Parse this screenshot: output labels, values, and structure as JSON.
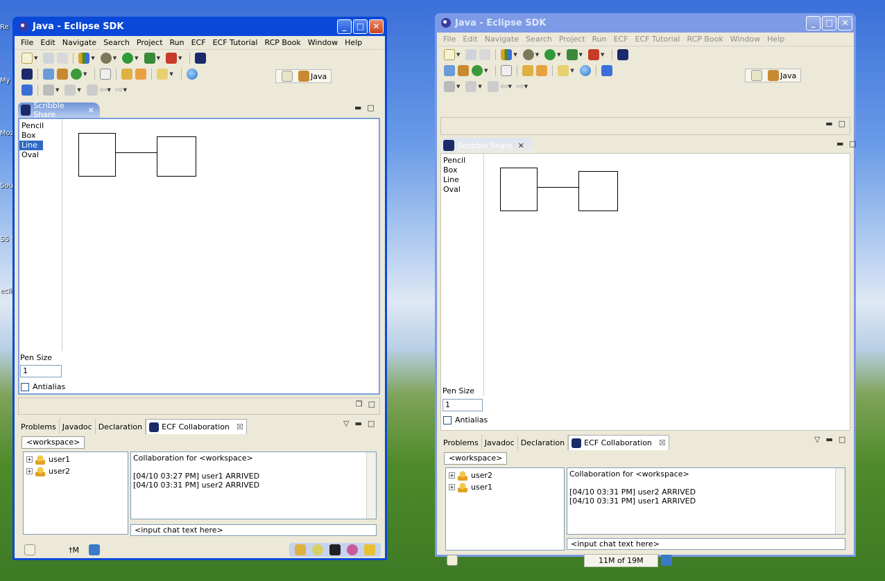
{
  "desktop": {
    "icons": [
      "Re",
      "My",
      "Moz",
      "Sou",
      "SS SH",
      "eclip"
    ]
  },
  "windows": [
    {
      "title": "Java - Eclipse SDK",
      "menu": [
        "File",
        "Edit",
        "Navigate",
        "Search",
        "Project",
        "Run",
        "ECF",
        "ECF Tutorial",
        "RCP Book",
        "Window",
        "Help"
      ],
      "perspective": "Java",
      "scribble_tab": "Scribble Share",
      "tools": [
        "Pencil",
        "Box",
        "Line",
        "Oval"
      ],
      "selected_tool": "Line",
      "pen_size_label": "Pen Size",
      "pen_size_value": "1",
      "antialias_label": "Antialias",
      "tabs": [
        "Problems",
        "Javadoc",
        "Declaration",
        "ECF Collaboration"
      ],
      "workspace_tab": "<workspace>",
      "users": [
        "user1",
        "user2"
      ],
      "chat_lines": [
        "Collaboration for <workspace>",
        "",
        "[04/10 03:27 PM] user1 ARRIVED",
        "[04/10 03:31 PM] user2 ARRIVED"
      ],
      "chat_input_placeholder": "<input chat text here>",
      "status_text": "†M"
    },
    {
      "title": "Java - Eclipse SDK",
      "menu": [
        "File",
        "Edit",
        "Navigate",
        "Search",
        "Project",
        "Run",
        "ECF",
        "ECF Tutorial",
        "RCP Book",
        "Window",
        "Help"
      ],
      "perspective": "Java",
      "scribble_tab": "Scribble Share",
      "tools": [
        "Pencil",
        "Box",
        "Line",
        "Oval"
      ],
      "selected_tool": "",
      "pen_size_label": "Pen Size",
      "pen_size_value": "1",
      "antialias_label": "Antialias",
      "tabs": [
        "Problems",
        "Javadoc",
        "Declaration",
        "ECF Collaboration"
      ],
      "workspace_tab": "<workspace>",
      "users": [
        "user2",
        "user1"
      ],
      "chat_lines": [
        "Collaboration for <workspace>",
        "",
        "[04/10 03:31 PM] user2 ARRIVED",
        "[04/10 03:31 PM] user1 ARRIVED"
      ],
      "chat_input_placeholder": "<input chat text here>",
      "status_text": "11M of 19M"
    }
  ],
  "colors": {
    "titlebar_active": "#0a49d8",
    "titlebar_inactive": "#7c9ae6",
    "selection": "#316ac5",
    "chrome": "#ece9d8"
  }
}
